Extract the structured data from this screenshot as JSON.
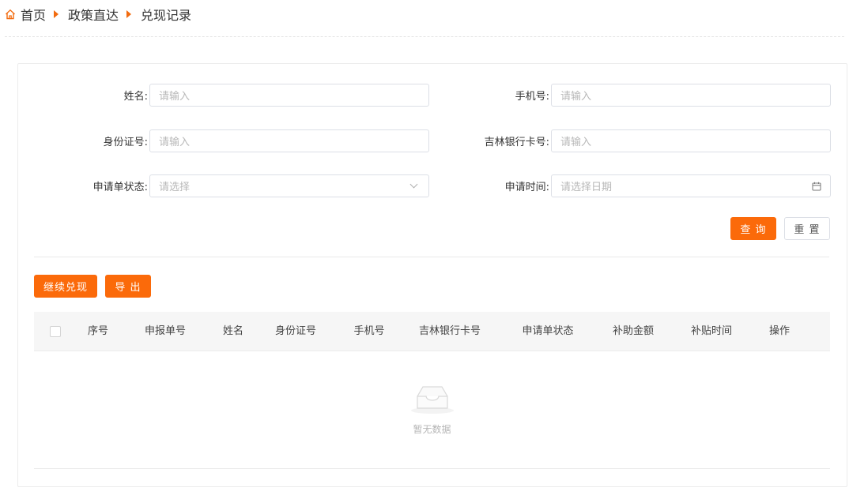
{
  "breadcrumb": {
    "icon": "home-icon",
    "items": [
      "首页",
      "政策直达",
      "兑现记录"
    ]
  },
  "form": {
    "name": {
      "label": "姓名:",
      "placeholder": "请输入"
    },
    "phone": {
      "label": "手机号:",
      "placeholder": "请输入"
    },
    "id_number": {
      "label": "身份证号:",
      "placeholder": "请输入"
    },
    "bank_card": {
      "label": "吉林银行卡号:",
      "placeholder": "请输入"
    },
    "status": {
      "label": "申请单状态:",
      "placeholder": "请选择"
    },
    "apply_time": {
      "label": "申请时间:",
      "placeholder": "请选择日期"
    }
  },
  "actions": {
    "query": "查 询",
    "reset": "重 置",
    "continue_redeem": "继续兑现",
    "export": "导 出"
  },
  "table": {
    "columns": [
      "序号",
      "申报单号",
      "姓名",
      "身份证号",
      "手机号",
      "吉林银行卡号",
      "申请单状态",
      "补助金额",
      "补贴时间",
      "操作"
    ],
    "rows": [],
    "empty_text": "暂无数据"
  },
  "colors": {
    "accent": "#fb6a0a",
    "breadcrumb_arrow": "#f26b0f"
  }
}
